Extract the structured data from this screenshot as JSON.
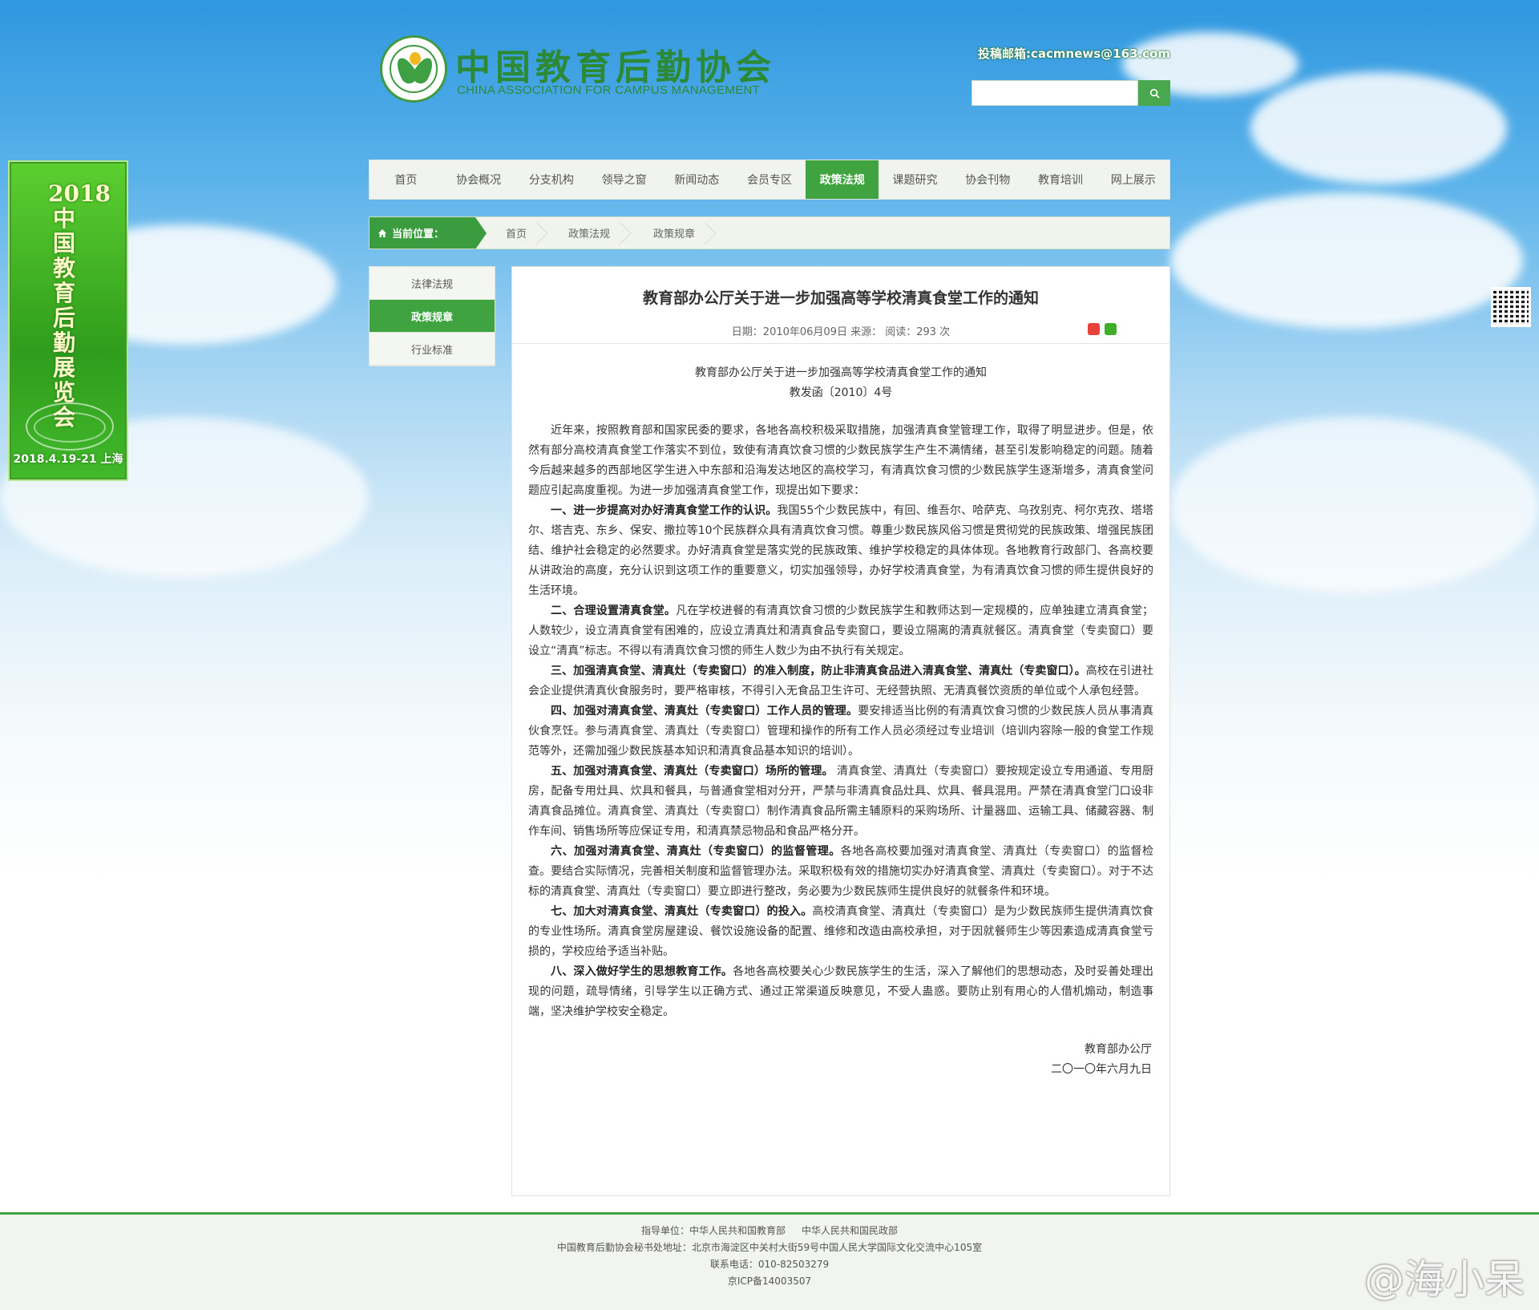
{
  "header": {
    "logo_cn": "中国教育后勤协会",
    "logo_en": "CHINA ASSOCIATION FOR CAMPUS MANAGEMENT",
    "contribute": "投稿邮箱:cacmnews@163.com",
    "search_placeholder": ""
  },
  "nav": [
    {
      "label": "首页"
    },
    {
      "label": "协会概况"
    },
    {
      "label": "分支机构"
    },
    {
      "label": "领导之窗"
    },
    {
      "label": "新闻动态"
    },
    {
      "label": "会员专区"
    },
    {
      "label": "政策法规",
      "active": true
    },
    {
      "label": "课题研究"
    },
    {
      "label": "协会刊物"
    },
    {
      "label": "教育培训"
    },
    {
      "label": "网上展示"
    }
  ],
  "breadcrumb": {
    "here_label": "当前位置：",
    "items": [
      "首页",
      "政策法规",
      "政策规章"
    ]
  },
  "side_menu": [
    {
      "label": "法律法规"
    },
    {
      "label": "政策规章",
      "active": true
    },
    {
      "label": "行业标准"
    }
  ],
  "article": {
    "title": "教育部办公厅关于进一步加强高等学校清真食堂工作的通知",
    "meta": "日期：2010年06月09日  来源：  阅读：293 次",
    "doc_title": "教育部办公厅关于进一步加强高等学校清真食堂工作的通知",
    "doc_number": "教发函〔2010〕4号",
    "intro": "近年来，按照教育部和国家民委的要求，各地各高校积极采取措施，加强清真食堂管理工作，取得了明显进步。但是，依然有部分高校清真食堂工作落实不到位，致使有清真饮食习惯的少数民族学生产生不满情绪，甚至引发影响稳定的问题。随着今后越来越多的西部地区学生进入中东部和沿海发达地区的高校学习，有清真饮食习惯的少数民族学生逐渐增多，清真食堂问题应引起高度重视。为进一步加强清真食堂工作，现提出如下要求：",
    "points": [
      {
        "head": "一、进一步提高对办好清真食堂工作的认识。",
        "text": "我国55个少数民族中，有回、维吾尔、哈萨克、乌孜别克、柯尔克孜、塔塔尔、塔吉克、东乡、保安、撒拉等10个民族群众具有清真饮食习惯。尊重少数民族风俗习惯是贯彻党的民族政策、增强民族团结、维护社会稳定的必然要求。办好清真食堂是落实党的民族政策、维护学校稳定的具体体现。各地教育行政部门、各高校要从讲政治的高度，充分认识到这项工作的重要意义，切实加强领导，办好学校清真食堂，为有清真饮食习惯的师生提供良好的生活环境。"
      },
      {
        "head": "二、合理设置清真食堂。",
        "text": "凡在学校进餐的有清真饮食习惯的少数民族学生和教师达到一定规模的，应单独建立清真食堂；人数较少，设立清真食堂有困难的，应设立清真灶和清真食品专卖窗口，要设立隔离的清真就餐区。清真食堂（专卖窗口）要设立“清真”标志。不得以有清真饮食习惯的师生人数少为由不执行有关规定。"
      },
      {
        "head": "三、加强清真食堂、清真灶（专卖窗口）的准入制度，防止非清真食品进入清真食堂、清真灶（专卖窗口）。",
        "text": "高校在引进社会企业提供清真伙食服务时，要严格审核，不得引入无食品卫生许可、无经营执照、无清真餐饮资质的单位或个人承包经营。"
      },
      {
        "head": "四、加强对清真食堂、清真灶（专卖窗口）工作人员的管理。",
        "text": "要安排适当比例的有清真饮食习惯的少数民族人员从事清真伙食烹饪。参与清真食堂、清真灶（专卖窗口）管理和操作的所有工作人员必须经过专业培训（培训内容除一般的食堂工作规范等外，还需加强少数民族基本知识和清真食品基本知识的培训）。"
      },
      {
        "head": "五、加强对清真食堂、清真灶（专卖窗口）场所的管理。",
        "text": " 清真食堂、清真灶（专卖窗口）要按规定设立专用通道、专用厨房，配备专用灶具、炊具和餐具，与普通食堂相对分开，严禁与非清真食品灶具、炊具、餐具混用。严禁在清真食堂门口设非清真食品摊位。清真食堂、清真灶（专卖窗口）制作清真食品所需主辅原料的采购场所、计量器皿、运输工具、储藏容器、制作车间、销售场所等应保证专用，和清真禁忌物品和食品严格分开。"
      },
      {
        "head": "六、加强对清真食堂、清真灶（专卖窗口）的监督管理。",
        "text": "各地各高校要加强对清真食堂、清真灶（专卖窗口）的监督检查。要结合实际情况，完善相关制度和监督管理办法。采取积极有效的措施切实办好清真食堂、清真灶（专卖窗口）。对于不达标的清真食堂、清真灶（专卖窗口）要立即进行整改，务必要为少数民族师生提供良好的就餐条件和环境。"
      },
      {
        "head": "七、加大对清真食堂、清真灶（专卖窗口）的投入。",
        "text": "高校清真食堂、清真灶（专卖窗口）是为少数民族师生提供清真饮食的专业性场所。清真食堂房屋建设、餐饮设施设备的配置、维修和改造由高校承担，对于因就餐师生少等因素造成清真食堂亏损的，学校应给予适当补贴。"
      },
      {
        "head": "八、深入做好学生的思想教育工作。",
        "text": "各地各高校要关心少数民族学生的生活，深入了解他们的思想动态，及时妥善处理出现的问题，疏导情绪，引导学生以正确方式、通过正常渠道反映意见，不受人蛊惑。要防止别有用心的人借机煽动，制造事端，坚决维护学校安全稳定。"
      }
    ],
    "sign_org": "教育部办公厅",
    "sign_date": "二〇一〇年六月九日"
  },
  "ad": {
    "text": "2018中国教育后勤展览会",
    "date": "2018.4.19-21 上海"
  },
  "footer": {
    "guide_label": "指导单位：中华人民共和国教育部",
    "guide_2": "中华人民共和国民政部",
    "address": "中国教育后勤协会秘书处地址：北京市海淀区中关村大街59号中国人民大学国际文化交流中心105室",
    "phone": "联系电话：010-82503279",
    "icp": "京ICP备14003507"
  },
  "watermark": "@海小呆",
  "colors": {
    "brand_green": "#3fa43f",
    "logo_green": "#2c8a36"
  }
}
